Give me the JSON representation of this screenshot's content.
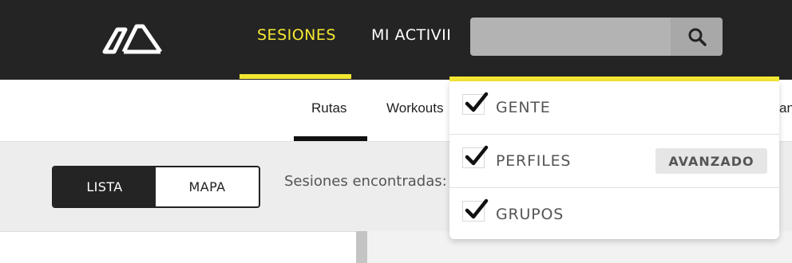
{
  "header": {
    "logo": "mountain-logo-icon",
    "nav": [
      {
        "label": "SESIONES",
        "active": true
      },
      {
        "label": "MI ACTIVID"
      }
    ]
  },
  "subnav": {
    "tabs": [
      {
        "label": "Rutas",
        "active": true
      },
      {
        "label": "Workouts"
      },
      {
        "label": "an"
      }
    ]
  },
  "view_toggle": {
    "lista": "LISTA",
    "mapa": "MAPA",
    "selected": "LISTA"
  },
  "results": {
    "label": "Sesiones encontradas:"
  },
  "search": {
    "value": "",
    "placeholder": "",
    "icon": "search-icon",
    "options": [
      {
        "label": "GENTE",
        "checked": true
      },
      {
        "label": "PERFILES",
        "checked": true,
        "badge": "AVANZADO"
      },
      {
        "label": "GRUPOS",
        "checked": true
      }
    ]
  },
  "colors": {
    "header_bg": "#242424",
    "accent_yellow": "#f5e832",
    "page_bg": "#ededed"
  }
}
